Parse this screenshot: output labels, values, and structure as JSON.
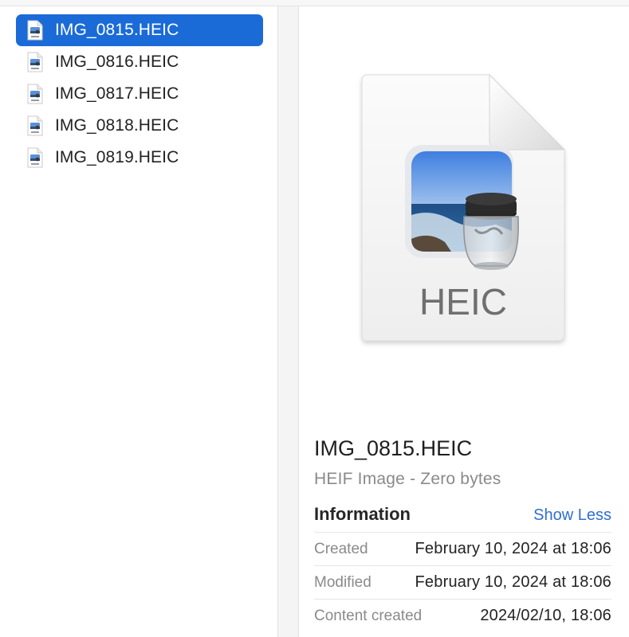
{
  "files": [
    {
      "name": "IMG_0815.HEIC",
      "selected": true
    },
    {
      "name": "IMG_0816.HEIC",
      "selected": false
    },
    {
      "name": "IMG_0817.HEIC",
      "selected": false
    },
    {
      "name": "IMG_0818.HEIC",
      "selected": false
    },
    {
      "name": "IMG_0819.HEIC",
      "selected": false
    }
  ],
  "preview": {
    "icon": "heic-document-icon",
    "icon_label": "HEIC",
    "name": "IMG_0815.HEIC",
    "kind": "HEIF Image - Zero bytes"
  },
  "information": {
    "heading": "Information",
    "toggle_label": "Show Less",
    "rows": [
      {
        "label": "Created",
        "value": "February 10, 2024 at 18:06"
      },
      {
        "label": "Modified",
        "value": "February 10, 2024 at 18:06"
      },
      {
        "label": "Content created",
        "value": "2024/02/10, 18:06"
      }
    ]
  },
  "colors": {
    "selection": "#1a6bd8",
    "link": "#2f6fd1",
    "secondary_text": "#8a8a8a"
  }
}
